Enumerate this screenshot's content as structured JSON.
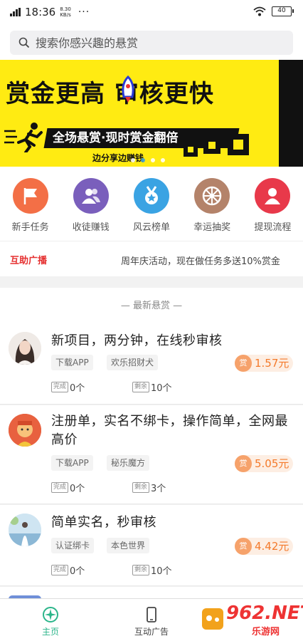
{
  "status_bar": {
    "time": "18:36",
    "net_speed": "8.30",
    "net_unit": "KB/s",
    "dots": "···",
    "battery": "40"
  },
  "search": {
    "placeholder": "搜索你感兴趣的悬赏"
  },
  "banner": {
    "title": "赏金更高  审核更快",
    "subtitle": "全场悬赏·现时赏金翻倍",
    "tagline": "边分享边赚钱",
    "colors": {
      "bg": "#ffeb12",
      "dark": "#111111",
      "dot_active": "#3fa0d8"
    },
    "indicator_count": 4,
    "indicator_active": 1
  },
  "quick_links": [
    {
      "label": "新手任务",
      "icon": "flag-icon",
      "color": "#f36f46"
    },
    {
      "label": "收徒赚钱",
      "icon": "users-icon",
      "color": "#7a5fbc"
    },
    {
      "label": "风云榜单",
      "icon": "medal-icon",
      "color": "#3aa3e3"
    },
    {
      "label": "幸运抽奖",
      "icon": "wheel-icon",
      "color": "#b4836a"
    },
    {
      "label": "提现流程",
      "icon": "user-icon",
      "color": "#e8394a"
    }
  ],
  "broadcast": {
    "label": "互助广播",
    "text": "周年庆活动，现在做任务多送10%赏金"
  },
  "section_title": "— 最新悬赏 —",
  "tasks": [
    {
      "title": "新项目，两分钟，在线秒审核",
      "tags": [
        "下载APP",
        "欢乐招财犬"
      ],
      "price": "1.57元",
      "done_label": "完成",
      "done": "0个",
      "left_label": "剩余",
      "left": "10个"
    },
    {
      "title": "注册单，实名不绑卡，操作简单，全网最高价",
      "tags": [
        "下载APP",
        "秘乐魔方"
      ],
      "price": "5.05元",
      "done_label": "完成",
      "done": "0个",
      "left_label": "剩余",
      "left": "3个"
    },
    {
      "title": "简单实名，秒审核",
      "tags": [
        "认证绑卡",
        "本色世界"
      ],
      "price": "4.42元",
      "done_label": "完成",
      "done": "0个",
      "left_label": "剩余",
      "left": "10个"
    }
  ],
  "price_badge": "赏",
  "bottom_nav": [
    {
      "label": "主页",
      "icon": "home-icon",
      "active": true
    },
    {
      "label": "互动广告",
      "icon": "phone-icon",
      "active": false
    }
  ],
  "watermark": {
    "big": "962.NET",
    "small": "乐游网"
  }
}
